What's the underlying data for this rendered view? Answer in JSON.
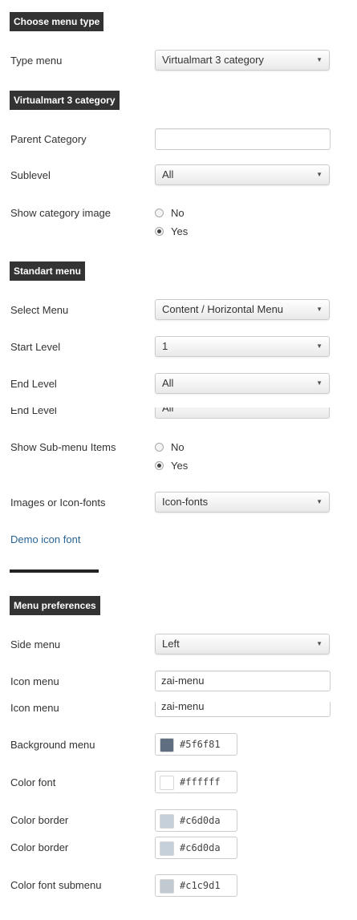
{
  "sections": {
    "choose_menu_type": "Choose menu type",
    "vm_category": "Virtualmart 3 category",
    "standart_menu": "Standart menu",
    "menu_preferences": "Menu preferences"
  },
  "type_menu": {
    "label": "Type menu",
    "value": "Virtualmart 3 category"
  },
  "parent_category": {
    "label": "Parent Category",
    "value": ""
  },
  "sublevel": {
    "label": "Sublevel",
    "value": "All"
  },
  "show_category_image": {
    "label": "Show category image",
    "options": [
      "No",
      "Yes"
    ],
    "selected": "Yes"
  },
  "select_menu": {
    "label": "Select Menu",
    "value": "Content / Horizontal Menu"
  },
  "start_level": {
    "label": "Start Level",
    "value": "1"
  },
  "end_level": {
    "label": "End Level",
    "value": "All"
  },
  "end_level_ghost": {
    "label": "End Level",
    "value": "All"
  },
  "show_submenu": {
    "label": "Show Sub-menu Items",
    "options": [
      "No",
      "Yes"
    ],
    "selected": "Yes"
  },
  "images_or_iconfonts": {
    "label": "Images or Icon-fonts",
    "value": "Icon-fonts"
  },
  "demo_link": "Demo icon font",
  "side_menu": {
    "label": "Side menu",
    "value": "Left"
  },
  "icon_menu": {
    "label": "Icon menu",
    "value": "zai-menu"
  },
  "icon_menu_ghost": {
    "label": "Icon menu",
    "value": "zai-menu"
  },
  "background_menu": {
    "label": "Background menu",
    "value": "#5f6f81",
    "swatch": "#5f6f81"
  },
  "color_font": {
    "label": "Color font",
    "value": "#ffffff",
    "swatch": "#ffffff"
  },
  "color_border": {
    "label": "Color border",
    "value": "#c6d0da",
    "swatch": "#c6d0da"
  },
  "color_border_ghost": {
    "label": "Color border",
    "value": "#c6d0da",
    "swatch": "#c6d0da"
  },
  "color_font_submenu": {
    "label": "Color font submenu",
    "value": "#c1c9d1",
    "swatch": "#c1c9d1"
  }
}
